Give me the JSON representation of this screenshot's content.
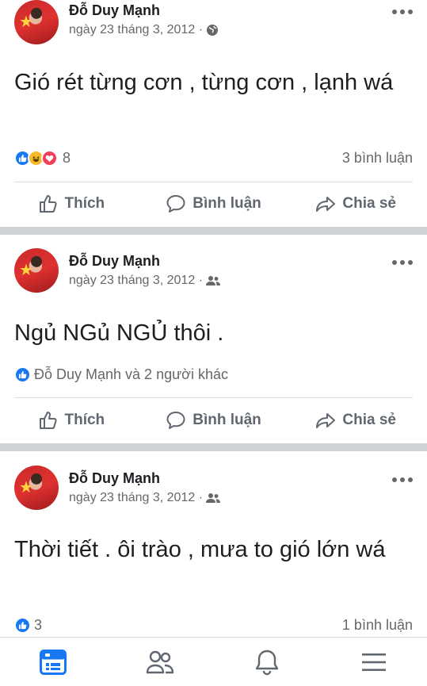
{
  "posts": [
    {
      "author": "Đỗ Duy Mạnh",
      "date": "ngày 23 tháng 3, 2012 ·",
      "privacy_icon": "globe-icon",
      "text": "Gió rét từng cơn , từng cơn , lạnh wá",
      "reactions": [
        "like",
        "haha",
        "love"
      ],
      "reaction_count": "8",
      "comments": "3 bình luận",
      "reacted_by": ""
    },
    {
      "author": "Đỗ Duy Mạnh",
      "date": "ngày 23 tháng 3, 2012 ·",
      "privacy_icon": "friends-icon",
      "text": "Ngủ NGủ NGỦ thôi .",
      "reactions": [
        "like"
      ],
      "reaction_count": "",
      "comments": "",
      "reacted_by": "Đỗ Duy Mạnh và 2 người khác"
    },
    {
      "author": "Đỗ Duy Mạnh",
      "date": "ngày 23 tháng 3, 2012 ·",
      "privacy_icon": "friends-icon",
      "text": "Thời tiết . ôi trào , mưa to gió lớn wá",
      "reactions": [
        "like"
      ],
      "reaction_count": "3",
      "comments": "1 bình luận",
      "reacted_by": ""
    }
  ],
  "actions": {
    "like": "Thích",
    "comment": "Bình luận",
    "share": "Chia sẻ"
  },
  "colors": {
    "accent": "#1877f2",
    "secondary_text": "#65676b",
    "separator": "#cfd2d6"
  },
  "tabbar": [
    "news-feed-icon",
    "friends-icon",
    "notifications-bell-icon",
    "menu-icon"
  ]
}
